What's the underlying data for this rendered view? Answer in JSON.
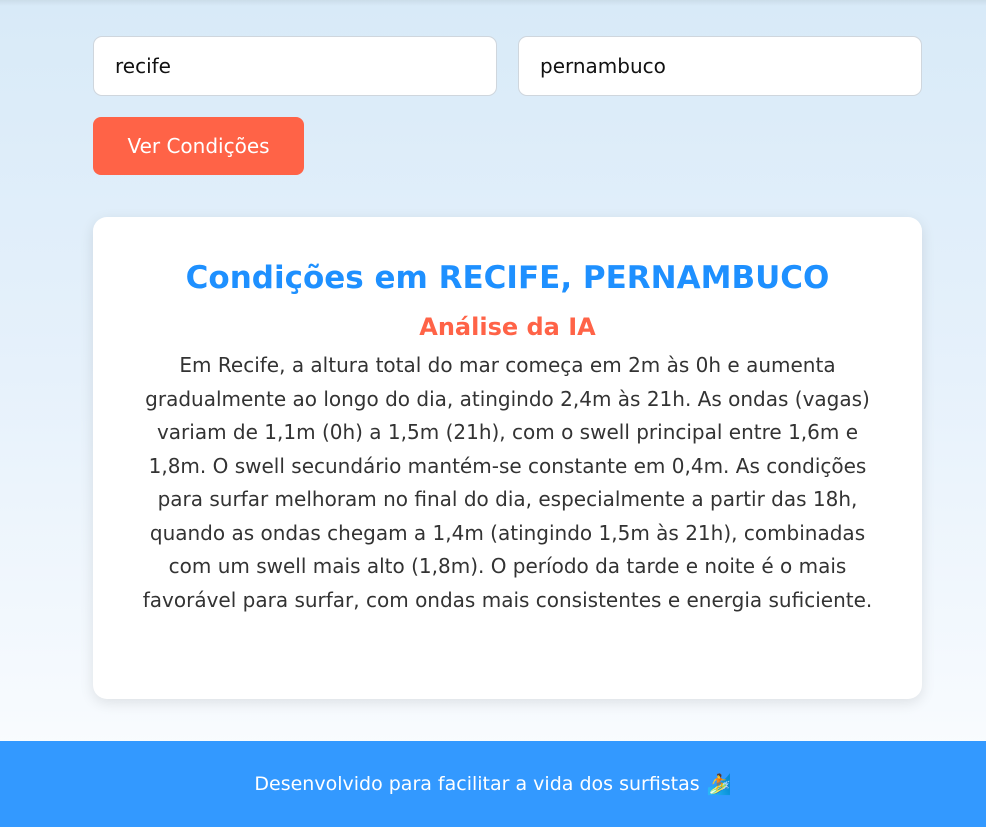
{
  "form": {
    "city_value": "recife",
    "state_value": "pernambuco",
    "submit_label": "Ver Condições"
  },
  "result": {
    "title": "Condições em RECIFE, PERNAMBUCO",
    "analysis_heading": "Análise da IA",
    "analysis_text": "Em Recife, a altura total do mar começa em 2m às 0h e aumenta gradualmente ao longo do dia, atingindo 2,4m às 21h. As ondas (vagas) variam de 1,1m (0h) a 1,5m (21h), com o swell principal entre 1,6m e 1,8m. O swell secundário mantém-se constante em 0,4m. As condições para surfar melhoram no final do dia, especialmente a partir das 18h, quando as ondas chegam a 1,4m (atingindo 1,5m às 21h), combinadas com um swell mais alto (1,8m). O período da tarde e noite é o mais favorável para surfar, com ondas mais consistentes e energia suficiente."
  },
  "footer": {
    "text": "Desenvolvido para facilitar a vida dos surfistas",
    "icon": "surfer-icon",
    "icon_glyph": "🏄"
  },
  "colors": {
    "accent_blue": "#1e90ff",
    "accent_orange": "#ff6347",
    "footer_blue": "#3399ff"
  }
}
